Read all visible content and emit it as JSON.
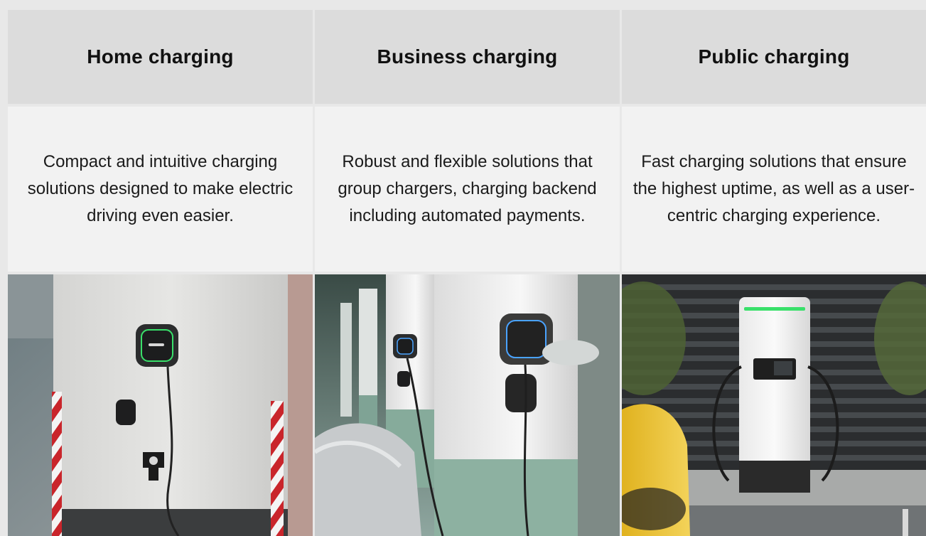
{
  "columns": [
    {
      "title": "Home charging",
      "description": "Compact and intuitive charging solutions designed to make electric driving even easier.",
      "image": "home-wall-charger-photo"
    },
    {
      "title": "Business charging",
      "description": "Robust and flexible solutions that group chargers, charging backend including automated payments.",
      "image": "business-parking-chargers-photo"
    },
    {
      "title": "Public charging",
      "description": "Fast charging solutions that ensure the highest uptime, as well as  a user-centric charging experience.",
      "image": "public-fast-charger-photo"
    }
  ],
  "colors": {
    "header_bg": "#dcdcdc",
    "description_bg": "#f2f2f2",
    "page_bg": "#e8e8e8",
    "charger_led_green": "#39e06a",
    "charger_led_blue": "#4aa3ff"
  }
}
